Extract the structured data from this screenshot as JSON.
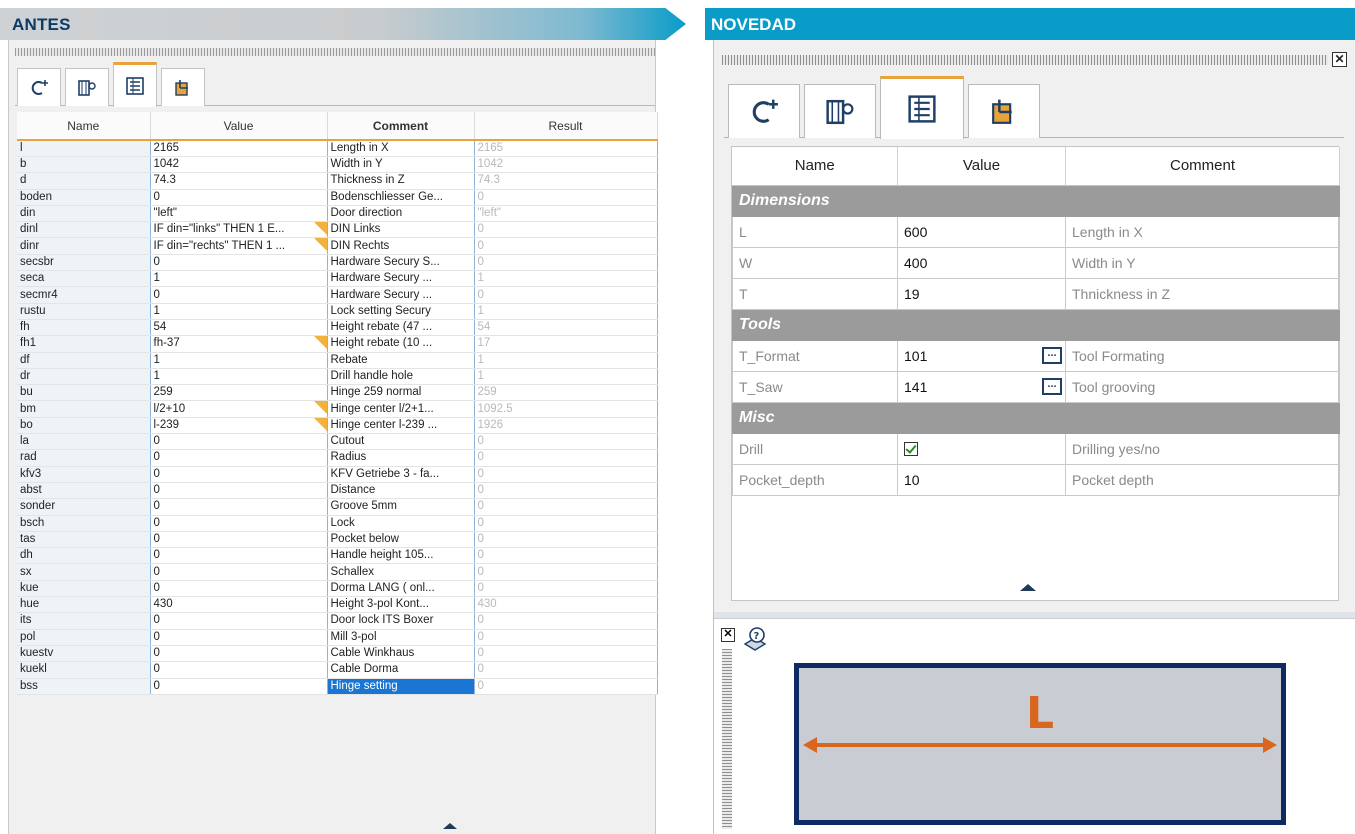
{
  "banners": {
    "left": "ANTES",
    "right": "NOVEDAD"
  },
  "left_panel": {
    "tabs": [
      "macro-icon",
      "settings-icon",
      "parameter-list-icon",
      "export-icon"
    ],
    "active_tab": 2,
    "columns": [
      "Name",
      "Value",
      "Comment",
      "Result"
    ],
    "rows": [
      {
        "name": "l",
        "value": "2165",
        "comment": "Length in X",
        "result": "2165"
      },
      {
        "name": "b",
        "value": "1042",
        "comment": "Width in Y",
        "result": "1042"
      },
      {
        "name": "d",
        "value": "74.3",
        "comment": "Thickness in Z",
        "result": "74.3"
      },
      {
        "name": "boden",
        "value": "0",
        "comment": "Bodenschliesser Ge...",
        "result": "0"
      },
      {
        "name": "din",
        "value": "\"left\"",
        "comment": "Door direction",
        "result": "\"left\""
      },
      {
        "name": "dinl",
        "value": "IF din=\"links\" THEN 1 E...",
        "comment": "DIN Links",
        "result": "0",
        "flag": true
      },
      {
        "name": "dinr",
        "value": "IF din=\"rechts\" THEN 1 ...",
        "comment": "DIN Rechts",
        "result": "0",
        "flag": true
      },
      {
        "name": "secsbr",
        "value": "0",
        "comment": "Hardware Secury S...",
        "result": "0"
      },
      {
        "name": "seca",
        "value": "1",
        "comment": "Hardware Secury ...",
        "result": "1"
      },
      {
        "name": "secmr4",
        "value": "0",
        "comment": "Hardware Secury ...",
        "result": "0"
      },
      {
        "name": "rustu",
        "value": "1",
        "comment": "Lock setting Secury",
        "result": "1"
      },
      {
        "name": "fh",
        "value": "54",
        "comment": "Height rebate (47 ...",
        "result": "54"
      },
      {
        "name": "fh1",
        "value": "fh-37",
        "comment": "Height rebate (10 ...",
        "result": "17",
        "flag": true
      },
      {
        "name": "df",
        "value": "1",
        "comment": "Rebate",
        "result": "1"
      },
      {
        "name": "dr",
        "value": "1",
        "comment": "Drill handle hole",
        "result": "1"
      },
      {
        "name": "bu",
        "value": "259",
        "comment": "Hinge 259 normal",
        "result": "259"
      },
      {
        "name": "bm",
        "value": "l/2+10",
        "comment": "Hinge center l/2+1...",
        "result": "1092.5",
        "flag": true
      },
      {
        "name": "bo",
        "value": "l-239",
        "comment": "Hinge center l-239 ...",
        "result": "1926",
        "flag": true
      },
      {
        "name": "la",
        "value": "0",
        "comment": "Cutout",
        "result": "0"
      },
      {
        "name": "rad",
        "value": "0",
        "comment": "Radius",
        "result": "0"
      },
      {
        "name": "kfv3",
        "value": "0",
        "comment": "KFV Getriebe 3 - fa...",
        "result": "0"
      },
      {
        "name": "abst",
        "value": "0",
        "comment": "Distance",
        "result": "0"
      },
      {
        "name": "sonder",
        "value": "0",
        "comment": "Groove 5mm",
        "result": "0"
      },
      {
        "name": "bsch",
        "value": "0",
        "comment": "Lock",
        "result": "0"
      },
      {
        "name": "tas",
        "value": "0",
        "comment": "Pocket below",
        "result": "0"
      },
      {
        "name": "dh",
        "value": "0",
        "comment": "Handle height 105...",
        "result": "0"
      },
      {
        "name": "sx",
        "value": "0",
        "comment": "Schallex",
        "result": "0"
      },
      {
        "name": "kue",
        "value": "0",
        "comment": "Dorma LANG ( onl...",
        "result": "0"
      },
      {
        "name": "hue",
        "value": "430",
        "comment": "Height 3-pol Kont...",
        "result": "430"
      },
      {
        "name": "its",
        "value": "0",
        "comment": "Door lock ITS Boxer",
        "result": "0"
      },
      {
        "name": "pol",
        "value": "0",
        "comment": "Mill 3-pol",
        "result": "0"
      },
      {
        "name": "kuestv",
        "value": "0",
        "comment": "Cable Winkhaus",
        "result": "0"
      },
      {
        "name": "kuekl",
        "value": "0",
        "comment": "Cable Dorma",
        "result": "0"
      },
      {
        "name": "bss",
        "value": "0",
        "comment": "Hinge setting",
        "result": "0",
        "selected": true
      }
    ]
  },
  "right_panel": {
    "close_glyph": "✕",
    "tabs": [
      "macro-icon",
      "settings-icon",
      "parameter-list-icon",
      "export-icon"
    ],
    "active_tab": 2,
    "columns": [
      "Name",
      "Value",
      "Comment"
    ],
    "sections": [
      {
        "title": "Dimensions",
        "rows": [
          {
            "name": "L",
            "value": "600",
            "comment": "Length in X"
          },
          {
            "name": "W",
            "value": "400",
            "comment": "Width in Y"
          },
          {
            "name": "T",
            "value": "19",
            "comment": "Thnickness in Z"
          }
        ]
      },
      {
        "title": "Tools",
        "rows": [
          {
            "name": "T_Format",
            "value": "101",
            "comment": "Tool Formating",
            "browse": true
          },
          {
            "name": "T_Saw",
            "value": "141",
            "comment": "Tool grooving",
            "browse": true
          }
        ]
      },
      {
        "title": "Misc",
        "rows": [
          {
            "name": "Drill",
            "value": "",
            "comment": "Drilling yes/no",
            "checkbox": true,
            "checked": true
          },
          {
            "name": "Pocket_depth",
            "value": "10",
            "comment": "Pocket depth"
          }
        ]
      }
    ],
    "browse_glyph": "...",
    "diagram": {
      "label": "L"
    }
  },
  "colors": {
    "accent_orange": "#e8a33a",
    "banner_blue": "#0a9cc9",
    "title_navy": "#0c3a64",
    "selection_blue": "#1a76d2",
    "section_gray": "#9b9b9b",
    "diagram_border": "#0e2a63",
    "diagram_arrow": "#d9661f"
  }
}
